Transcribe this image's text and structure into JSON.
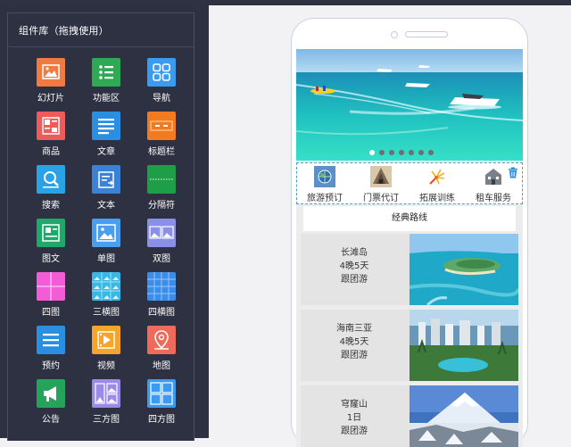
{
  "sidebar": {
    "title": "组件库（拖拽使用）",
    "components": [
      {
        "label": "幻灯片",
        "icon": "slideshow-icon",
        "color": "#f07a42"
      },
      {
        "label": "功能区",
        "icon": "function-list-icon",
        "color": "#2eaa55"
      },
      {
        "label": "导航",
        "icon": "nav-grid-icon",
        "color": "#3a9bf0"
      },
      {
        "label": "商品",
        "icon": "product-icon",
        "color": "#ef5a5a"
      },
      {
        "label": "文章",
        "icon": "article-icon",
        "color": "#2a8fe0"
      },
      {
        "label": "标题栏",
        "icon": "titlebar-icon",
        "color": "#f27a20"
      },
      {
        "label": "搜索",
        "icon": "search-icon",
        "color": "#29a3e6"
      },
      {
        "label": "文本",
        "icon": "text-icon",
        "color": "#3a82d6"
      },
      {
        "label": "分隔符",
        "icon": "divider-icon",
        "color": "#1f9e48"
      },
      {
        "label": "图文",
        "icon": "image-text-icon",
        "color": "#1fa86a"
      },
      {
        "label": "单图",
        "icon": "single-image-icon",
        "color": "#4a9ef0"
      },
      {
        "label": "双图",
        "icon": "double-image-icon",
        "color": "#8a8fe8"
      },
      {
        "label": "四图",
        "icon": "four-image-icon",
        "color": "#f25cd6"
      },
      {
        "label": "三横图",
        "icon": "three-row-image-icon",
        "color": "#36b8e8"
      },
      {
        "label": "四横图",
        "icon": "four-row-image-icon",
        "color": "#3a8de8"
      },
      {
        "label": "预约",
        "icon": "booking-icon",
        "color": "#2a8fe0"
      },
      {
        "label": "视频",
        "icon": "video-icon",
        "color": "#f4a52a"
      },
      {
        "label": "地图",
        "icon": "map-pin-icon",
        "color": "#ef6a5a"
      },
      {
        "label": "公告",
        "icon": "megaphone-icon",
        "color": "#26a35a"
      },
      {
        "label": "三方图",
        "icon": "three-grid-image-icon",
        "color": "#9b8ae8"
      },
      {
        "label": "四方图",
        "icon": "four-grid-image-icon",
        "color": "#3a9bf0"
      }
    ]
  },
  "preview": {
    "banner_dots": 7,
    "banner_active_dot": 0,
    "nav_items": [
      {
        "label": "旅游预订",
        "icon": "globe-icon"
      },
      {
        "label": "门票代订",
        "icon": "temple-icon"
      },
      {
        "label": "拓展训练",
        "icon": "fireworks-icon"
      },
      {
        "label": "租车服务",
        "icon": "building-icon"
      }
    ],
    "routes_title": "经典路线",
    "routes": [
      {
        "name": "长滩岛",
        "duration": "4晚5天",
        "type": "跟团游"
      },
      {
        "name": "海南三亚",
        "duration": "4晚5天",
        "type": "跟团游"
      },
      {
        "name": "穹窿山",
        "duration": "1日",
        "type": "跟团游"
      }
    ]
  },
  "colors": {
    "sidebar_bg": "#2e3142",
    "canvas_bg": "#f2f2f4",
    "selection_border": "#47a3c9"
  }
}
